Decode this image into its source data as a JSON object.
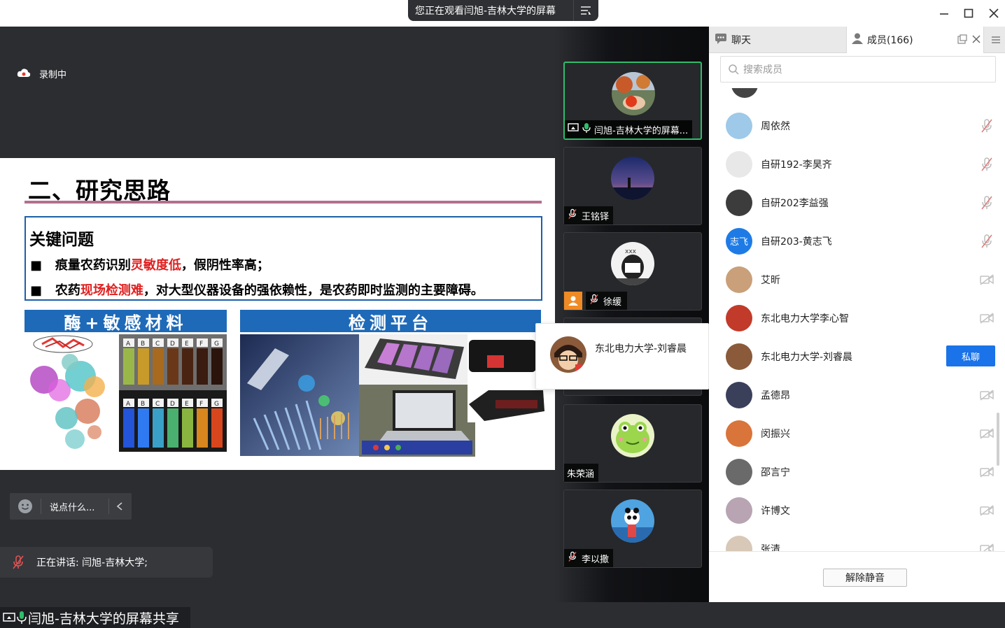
{
  "titlebar": {
    "watching_text": "您正在观看闫旭-吉林大学的屏幕",
    "menu_icon": "list-menu-icon",
    "minimize_icon": "minimize-icon",
    "maximize_icon": "maximize-icon",
    "close_icon": "close-icon"
  },
  "share": {
    "recording_label": "录制中",
    "slide": {
      "title": "二、研究思路",
      "key_title": "关键问题",
      "line1": {
        "bullet": "■",
        "pre": "痕量农药识别",
        "red": "灵敏度低",
        "post": "，假阴性率高；"
      },
      "line2": {
        "bullet": "■",
        "pre": "农药",
        "red": "现场检测难",
        "post": "，对大型仪器设备的强依赖性，是农药即时监测的主要障碍。"
      },
      "section_left": "酶+敏感材料",
      "section_right": "检测平台",
      "vial_letters": [
        "A",
        "B",
        "C",
        "D",
        "E",
        "F",
        "G"
      ]
    },
    "chat_placeholder": "说点什么...",
    "speaking_label": "正在讲话: 闫旭-吉林大学;",
    "share_label": "闫旭-吉林大学的屏幕共享"
  },
  "video_tiles": [
    {
      "name": "闫旭-吉林大学的屏幕...",
      "mic": "on"
    },
    {
      "name": "王铭铎",
      "mic": "muted"
    },
    {
      "name": "徐缓",
      "mic": "muted"
    },
    {
      "name": "",
      "mic": ""
    },
    {
      "name": "朱荣涵",
      "mic": "none"
    },
    {
      "name": "李以撒",
      "mic": "muted"
    }
  ],
  "popover": {
    "name": "东北电力大学-刘睿晨"
  },
  "panel": {
    "tab_chat": "聊天",
    "tab_members": "成员(166)",
    "search_placeholder": "搜索成员",
    "members": [
      {
        "name": "周依然",
        "status": "mic-muted"
      },
      {
        "name": "自研192-李昊齐",
        "status": "mic-muted"
      },
      {
        "name": "自研202李益强",
        "status": "mic-muted"
      },
      {
        "name": "自研203-黄志飞",
        "status": "mic-muted",
        "avatar_text": "志飞"
      },
      {
        "name": "艾昕",
        "status": "video-off"
      },
      {
        "name": "东北电力大学李心智",
        "status": "video-off"
      },
      {
        "name": "东北电力大学-刘睿晨",
        "status": "private-chat"
      },
      {
        "name": "孟德昂",
        "status": "video-off"
      },
      {
        "name": "闵振兴",
        "status": "video-off"
      },
      {
        "name": "邵言宁",
        "status": "video-off"
      },
      {
        "name": "许博文",
        "status": "video-off"
      },
      {
        "name": "张清",
        "status": "video-off"
      }
    ],
    "private_chat_label": "私聊",
    "unmute_label": "解除静音"
  },
  "colors": {
    "accent": "#1a73e8",
    "active_speaker": "#2fbd6a",
    "highlight_red": "#e02020",
    "section_blue": "#1e6ab8"
  }
}
